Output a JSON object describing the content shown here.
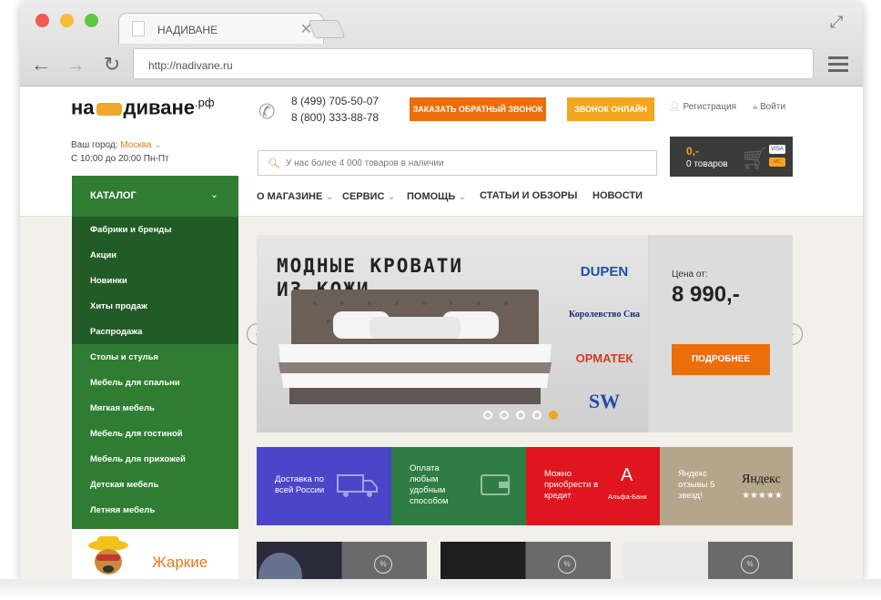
{
  "browser": {
    "tab_title": "НАДИВАНЕ",
    "tab_close": "✕",
    "url": "http://nadivane.ru",
    "traffic_colors": [
      "#ee5c55",
      "#f5bd3a",
      "#5ec640"
    ]
  },
  "header": {
    "logo_left": "на",
    "logo_right": "диване",
    "logo_suffix": ".рф",
    "city_label": "Ваш город:",
    "city_value": "Москва",
    "hours": "С 10:00 до 20:00 Пн-Пт",
    "phones": [
      "8 (499) 705-50-07",
      "8 (800) 333-88-78"
    ],
    "callback_button": "ЗАКАЗАТЬ ОБРАТНЫЙ ЗВОНОК",
    "online_call_button": "ЗВОНОК ОНЛАЙН",
    "register_link": "Регистрация",
    "login_link": "Войти",
    "search_placeholder": "У нас более 4 000 товаров в наличии",
    "cart_price": "0,-",
    "cart_count": "0 товаров",
    "card_labels": [
      "VISA",
      "MC"
    ],
    "nav": [
      "О МАГАЗИНЕ",
      "СЕРВИС",
      "ПОМОЩЬ",
      "СТАТЬИ И ОБЗОРЫ",
      "НОВОСТИ"
    ]
  },
  "catalog": {
    "title": "КАТАЛОГ",
    "items": [
      "Фабрики и бренды",
      "Акции",
      "Новинки",
      "Хиты продаж",
      "Распродажа",
      "Столы и стулья",
      "Мебель для спальни",
      "Мягкая мебель",
      "Мебель для гостиной",
      "Мебель для прихожей",
      "Детская мебель",
      "Летняя мебель"
    ],
    "promo_text": "Жаркие"
  },
  "slider": {
    "title_line1": "МОДНЫЕ КРОВАТИ",
    "title_line2": "ИЗ КОЖИ",
    "brands": [
      "DUPEN",
      "Королевство Сна",
      "ОРМАТЕК",
      "SW"
    ],
    "price_label": "Цена от:",
    "price_value": "8 990,-",
    "more_button": "ПОДРОБНЕЕ",
    "slide_count": 5,
    "active_slide": 5,
    "prev_arrow": "‹",
    "next_arrow": "›"
  },
  "features": [
    {
      "text": "Доставка по всей России",
      "color": "#4a45c9"
    },
    {
      "text": "Оплата любым удобным способом",
      "color": "#2f7d44"
    },
    {
      "text": "Можно приобрести в кредит",
      "color": "#e0161f",
      "sub": "Альфа-Банк",
      "logo": "А"
    },
    {
      "text": "Яндекс отзывы 5 звезд!",
      "color": "#b5a58a",
      "logo": "Яндекс",
      "stars": "★★★★★"
    }
  ],
  "thumb_badge": "%"
}
